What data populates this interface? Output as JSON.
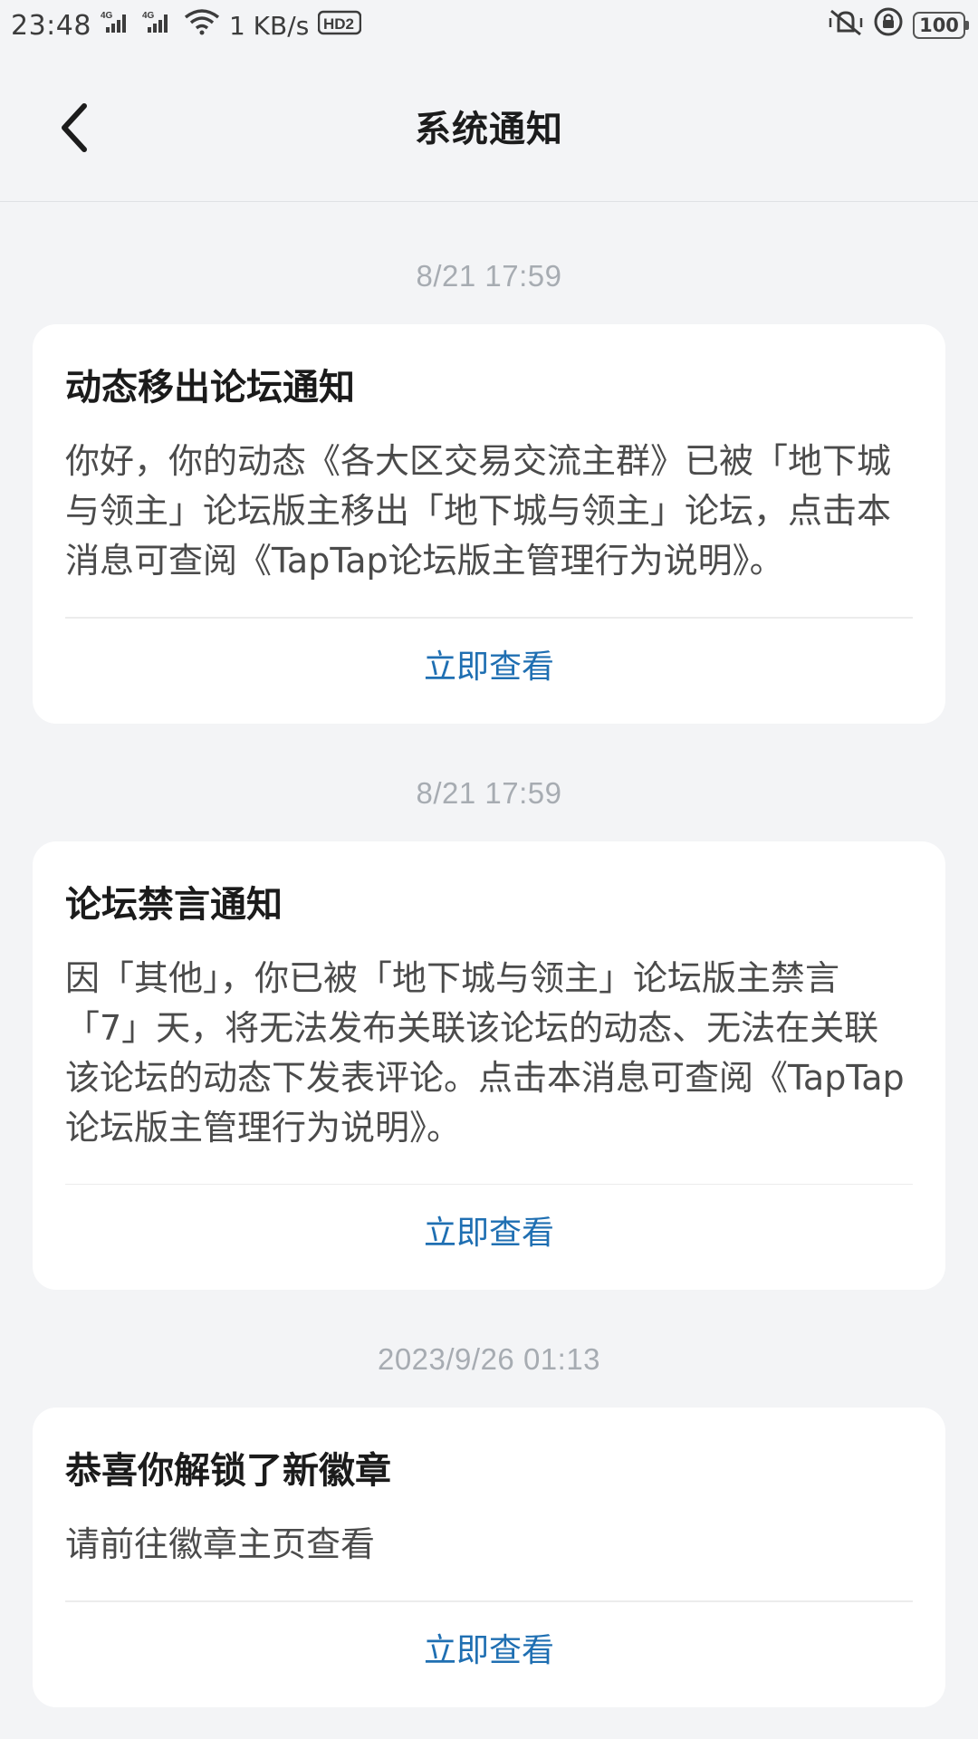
{
  "status_bar": {
    "time": "23:48",
    "network_speed": "1 KB/s",
    "signal_1": "4G",
    "signal_2": "4G",
    "hd_label": "HD2",
    "battery": "100"
  },
  "header": {
    "title": "系统通知",
    "back_icon": "chevron-left-icon"
  },
  "notifications": [
    {
      "timestamp": "8/21  17:59",
      "title": "动态移出论坛通知",
      "body": "你好，你的动态《各大区交易交流主群》已被「地下城与领主」论坛版主移出「地下城与领主」论坛，点击本消息可查阅《TapTap论坛版主管理行为说明》。",
      "action": "立即查看"
    },
    {
      "timestamp": "8/21  17:59",
      "title": "论坛禁言通知",
      "body": "因「其他」，你已被「地下城与领主」论坛版主禁言「7」天，将无法发布关联该论坛的动态、无法在关联该论坛的动态下发表评论。点击本消息可查阅《TapTap论坛版主管理行为说明》。",
      "action": "立即查看"
    },
    {
      "timestamp": "2023/9/26  01:13",
      "title": "恭喜你解锁了新徽章",
      "body": "请前往徽章主页查看",
      "action": "立即查看"
    }
  ],
  "colors": {
    "background": "#f3f4f6",
    "card": "#ffffff",
    "action_link": "#1f6fb2",
    "timestamp": "#a7acb2"
  }
}
